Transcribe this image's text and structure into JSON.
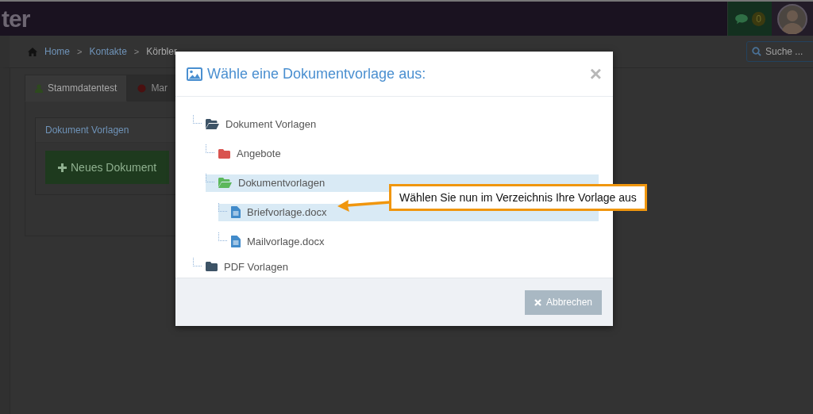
{
  "header": {
    "logo": "ter",
    "chat_badge": "0"
  },
  "breadcrumb": {
    "items": [
      "Home",
      "Kontakte",
      "Körbler"
    ],
    "separator": ">"
  },
  "search": {
    "placeholder": "Suche ..."
  },
  "tabs": [
    {
      "label": "Stammdatentest",
      "selected": true
    },
    {
      "label": "Mar",
      "selected": false
    }
  ],
  "panel": {
    "title": "Dokument Vorlagen",
    "button": "Neues Dokument"
  },
  "dialog": {
    "title": "Wähle eine Dokumentvorlage aus:",
    "close": "×",
    "tree": [
      {
        "kind": "folder",
        "label": "Dokument Vorlagen",
        "color": "#3d5366",
        "expanded": true,
        "selected": false,
        "children": [
          {
            "kind": "folder",
            "label": "Angebote",
            "color": "#d9534f",
            "expanded": false,
            "selected": false
          },
          {
            "kind": "folder",
            "label": "Dokumentvorlagen",
            "color": "#5cb85c",
            "expanded": true,
            "selected": true,
            "children": [
              {
                "kind": "file",
                "label": "Briefvorlage.docx",
                "color": "#428bca",
                "selected": true
              },
              {
                "kind": "file",
                "label": "Mailvorlage.docx",
                "color": "#428bca",
                "selected": false
              }
            ]
          }
        ]
      },
      {
        "kind": "folder",
        "label": "PDF Vorlagen",
        "color": "#3d5366",
        "expanded": false,
        "selected": false
      }
    ],
    "cancel_button": "Abbrechen"
  },
  "callout": {
    "text": "Wählen Sie nun im Verzeichnis Ihre Vorlage aus"
  }
}
